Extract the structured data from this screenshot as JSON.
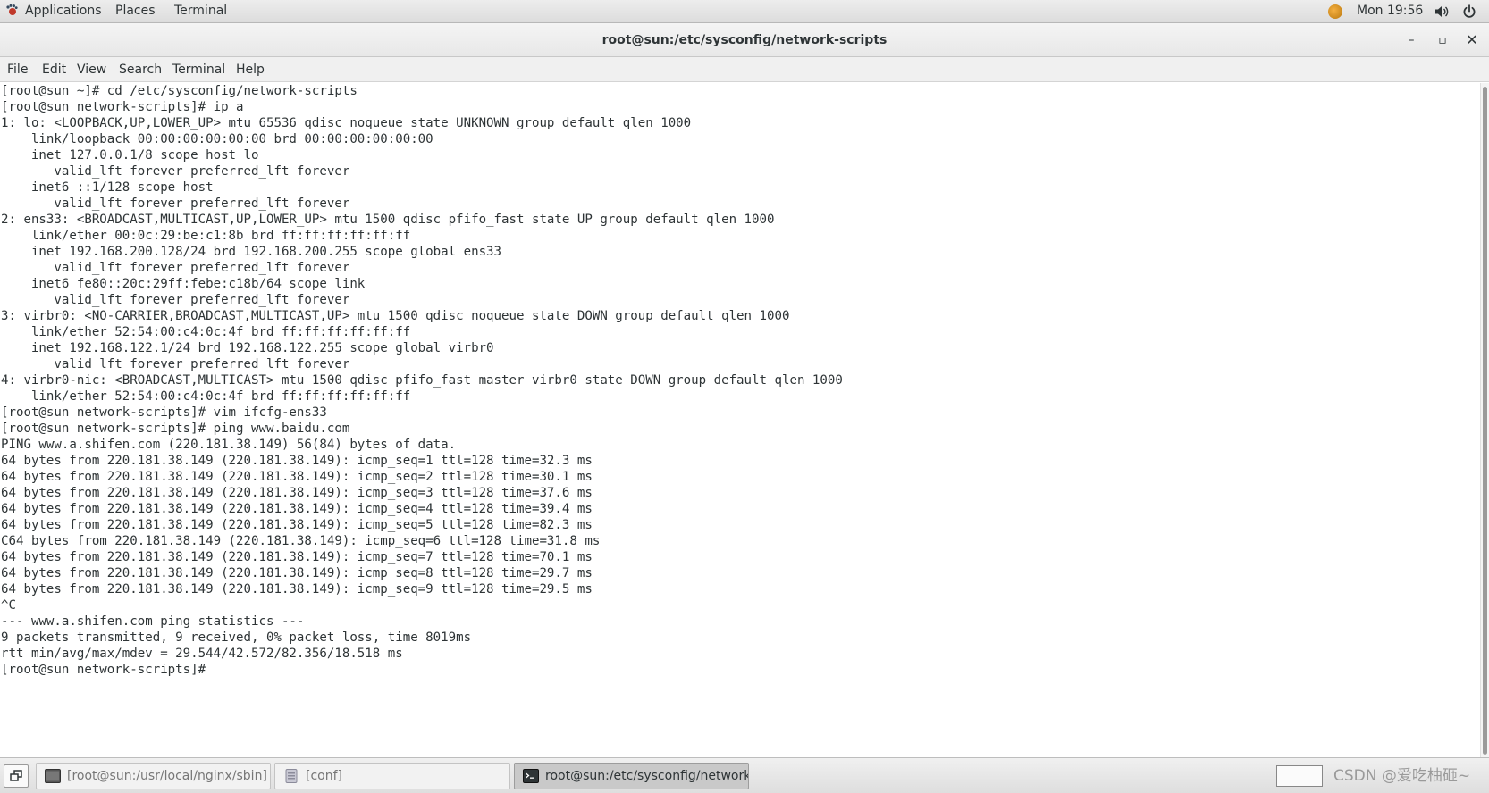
{
  "top_panel": {
    "applications_label": "Applications",
    "places_label": "Places",
    "terminal_label": "Terminal",
    "clock": "Mon 19:56"
  },
  "window": {
    "title": "root@sun:/etc/sysconfig/network-scripts",
    "minimize_glyph": "–",
    "maximize_glyph": "▫",
    "close_glyph": "✕"
  },
  "menubar": {
    "items": [
      "File",
      "Edit",
      "View",
      "Search",
      "Terminal",
      "Help"
    ]
  },
  "terminal": {
    "output": "[root@sun ~]# cd /etc/sysconfig/network-scripts\n[root@sun network-scripts]# ip a\n1: lo: <LOOPBACK,UP,LOWER_UP> mtu 65536 qdisc noqueue state UNKNOWN group default qlen 1000\n    link/loopback 00:00:00:00:00:00 brd 00:00:00:00:00:00\n    inet 127.0.0.1/8 scope host lo\n       valid_lft forever preferred_lft forever\n    inet6 ::1/128 scope host\n       valid_lft forever preferred_lft forever\n2: ens33: <BROADCAST,MULTICAST,UP,LOWER_UP> mtu 1500 qdisc pfifo_fast state UP group default qlen 1000\n    link/ether 00:0c:29:be:c1:8b brd ff:ff:ff:ff:ff:ff\n    inet 192.168.200.128/24 brd 192.168.200.255 scope global ens33\n       valid_lft forever preferred_lft forever\n    inet6 fe80::20c:29ff:febe:c18b/64 scope link\n       valid_lft forever preferred_lft forever\n3: virbr0: <NO-CARRIER,BROADCAST,MULTICAST,UP> mtu 1500 qdisc noqueue state DOWN group default qlen 1000\n    link/ether 52:54:00:c4:0c:4f brd ff:ff:ff:ff:ff:ff\n    inet 192.168.122.1/24 brd 192.168.122.255 scope global virbr0\n       valid_lft forever preferred_lft forever\n4: virbr0-nic: <BROADCAST,MULTICAST> mtu 1500 qdisc pfifo_fast master virbr0 state DOWN group default qlen 1000\n    link/ether 52:54:00:c4:0c:4f brd ff:ff:ff:ff:ff:ff\n[root@sun network-scripts]# vim ifcfg-ens33\n[root@sun network-scripts]# ping www.baidu.com\nPING www.a.shifen.com (220.181.38.149) 56(84) bytes of data.\n64 bytes from 220.181.38.149 (220.181.38.149): icmp_seq=1 ttl=128 time=32.3 ms\n64 bytes from 220.181.38.149 (220.181.38.149): icmp_seq=2 ttl=128 time=30.1 ms\n64 bytes from 220.181.38.149 (220.181.38.149): icmp_seq=3 ttl=128 time=37.6 ms\n64 bytes from 220.181.38.149 (220.181.38.149): icmp_seq=4 ttl=128 time=39.4 ms\n64 bytes from 220.181.38.149 (220.181.38.149): icmp_seq=5 ttl=128 time=82.3 ms\nC64 bytes from 220.181.38.149 (220.181.38.149): icmp_seq=6 ttl=128 time=31.8 ms\n64 bytes from 220.181.38.149 (220.181.38.149): icmp_seq=7 ttl=128 time=70.1 ms\n64 bytes from 220.181.38.149 (220.181.38.149): icmp_seq=8 ttl=128 time=29.7 ms\n64 bytes from 220.181.38.149 (220.181.38.149): icmp_seq=9 ttl=128 time=29.5 ms\n^C\n--- www.a.shifen.com ping statistics ---\n9 packets transmitted, 9 received, 0% packet loss, time 8019ms\nrtt min/avg/max/mdev = 29.544/42.572/82.356/18.518 ms\n[root@sun network-scripts]# "
  },
  "taskbar": {
    "tasks": [
      {
        "label": "[root@sun:/usr/local/nginx/sbin]",
        "icon": "terminal-icon",
        "active": false
      },
      {
        "label": "[conf]",
        "icon": "file-manager-icon",
        "active": false
      },
      {
        "label": "root@sun:/etc/sysconfig/network-s...",
        "icon": "terminal-icon",
        "active": true
      }
    ],
    "watermark": "CSDN @爱吃柚砸~"
  },
  "colors": {
    "terminal_bg": "#ffffff",
    "terminal_fg": "#2e3436",
    "panel_bg": "#e4e4e4"
  }
}
